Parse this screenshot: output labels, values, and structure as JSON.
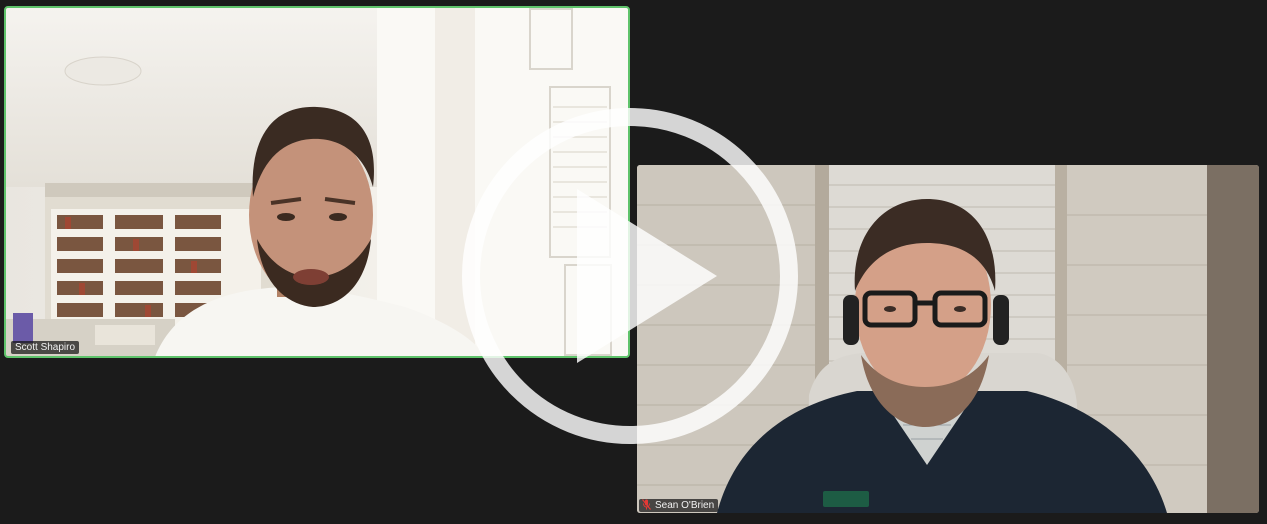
{
  "participants": [
    {
      "name": "Scott Shapiro",
      "active_speaker": true,
      "muted": false
    },
    {
      "name": "Sean O'Brien",
      "muted": true
    }
  ],
  "overlay": {
    "icon": "play-icon"
  },
  "colors": {
    "background": "#1b1b1b",
    "active_speaker_border": "#5fc36b",
    "muted_icon": "#e53935",
    "play_overlay": "#ffffff"
  }
}
